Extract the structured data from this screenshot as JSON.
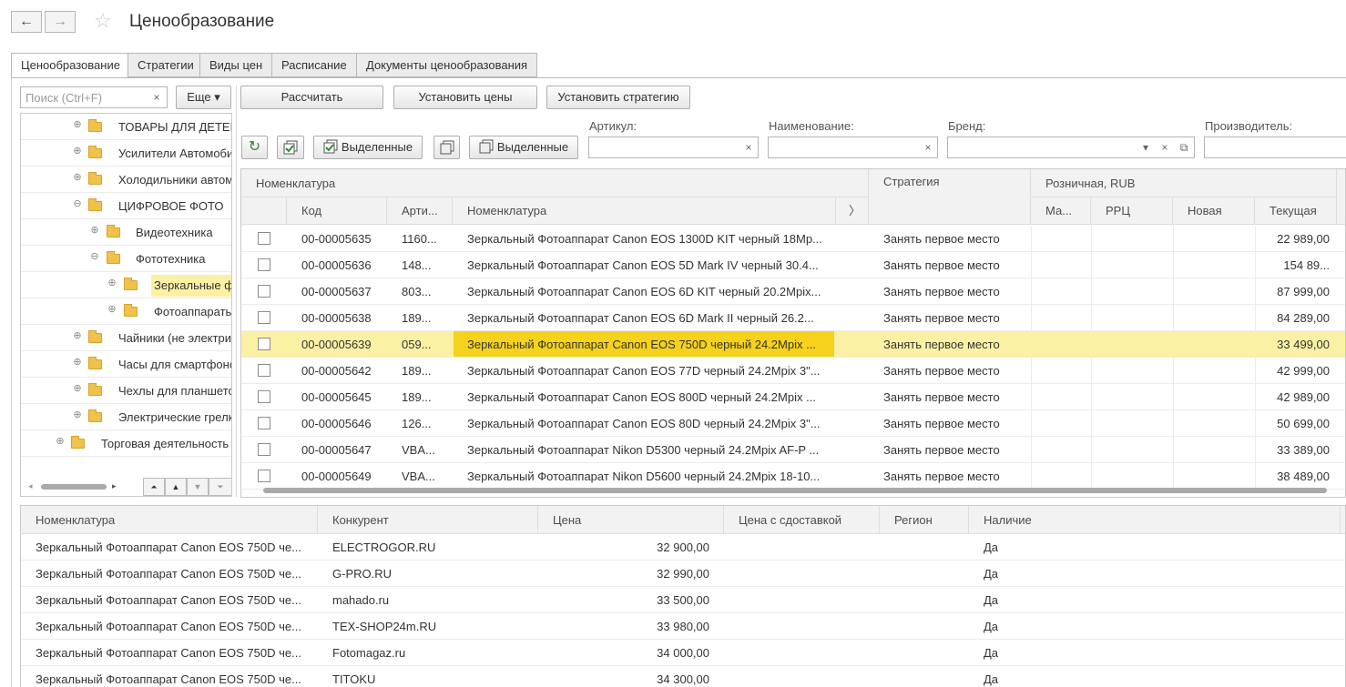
{
  "window": {
    "title": "Ценообразование",
    "back_icon": "←",
    "forward_icon": "→",
    "star_icon": "☆"
  },
  "tabs": [
    {
      "label": "Ценообразование",
      "active": true
    },
    {
      "label": "Стратегии"
    },
    {
      "label": "Виды цен"
    },
    {
      "label": "Расписание"
    },
    {
      "label": "Документы ценообразования"
    }
  ],
  "search": {
    "placeholder": "Поиск (Ctrl+F)",
    "clear": "×",
    "more_label": "Еще ▾"
  },
  "actions": {
    "calculate": "Рассчитать",
    "set_prices": "Установить цены",
    "set_strategy": "Установить стратегию"
  },
  "toolbar": {
    "refresh_icon": "↻",
    "check_selected": "Выделенные",
    "uncheck_selected": "Выделенные"
  },
  "filters": {
    "article": {
      "label": "Артикул:",
      "clear": "×"
    },
    "name": {
      "label": "Наименование:",
      "clear": "×"
    },
    "brand": {
      "label": "Бренд:",
      "dropdown": "▾",
      "clear": "×",
      "open": "⧉"
    },
    "manufacturer": {
      "label": "Производитель:"
    }
  },
  "tree": {
    "items": [
      {
        "label": "ТОВАРЫ ДЛЯ ДЕТЕЙ",
        "expander": "⊕"
      },
      {
        "label": "Усилители Автомобильные",
        "expander": "⊕"
      },
      {
        "label": "Холодильники автомобильные",
        "expander": "⊕"
      },
      {
        "label": "ЦИФРОВОЕ ФОТО",
        "expander": "⊖"
      },
      {
        "label": "Видеотехника",
        "expander": "⊕"
      },
      {
        "label": "Фототехника",
        "expander": "⊖"
      },
      {
        "label": "Зеркальные фотоаппараты",
        "expander": "⊕",
        "selected": true
      },
      {
        "label": "Фотоаппараты",
        "expander": "⊕"
      },
      {
        "label": "Чайники (не электрические)",
        "expander": "⊕"
      },
      {
        "label": "Часы для смартфонов",
        "expander": "⊕"
      },
      {
        "label": "Чехлы для планшетов",
        "expander": "⊕"
      },
      {
        "label": "Электрические грелки",
        "expander": "⊕"
      },
      {
        "label": "Торговая деятельность",
        "expander": "⊕"
      }
    ],
    "scroll_left": "◂",
    "scroll_right": "▸",
    "nav": {
      "first": "⏶",
      "up": "▲",
      "down": "▼",
      "last": "⏷"
    }
  },
  "grid": {
    "group_headers": {
      "nomenclature": "Номенклатура",
      "strategy": "Стратегия",
      "retail": "Розничная, RUB"
    },
    "columns": {
      "code": "Код",
      "article": "Арти...",
      "name": "Номенклатура",
      "chevron": "〉",
      "min": "Ма...",
      "rrc": "РРЦ",
      "new": "Новая",
      "current": "Текущая"
    },
    "rows": [
      {
        "code": "00-00005635",
        "article": "1160...",
        "name": "Зеркальный Фотоаппарат Canon EOS 1300D KIT черный 18Mp...",
        "strategy": "Занять первое место",
        "current": "22 989,00"
      },
      {
        "code": "00-00005636",
        "article": "148...",
        "name": "Зеркальный Фотоаппарат Canon EOS 5D Mark IV черный 30.4...",
        "strategy": "Занять первое место",
        "current": "154 89..."
      },
      {
        "code": "00-00005637",
        "article": "803...",
        "name": "Зеркальный Фотоаппарат Canon EOS 6D KIT черный 20.2Mpix...",
        "strategy": "Занять первое место",
        "current": "87 999,00"
      },
      {
        "code": "00-00005638",
        "article": "189...",
        "name": "Зеркальный Фотоаппарат Canon EOS 6D Mark II черный 26.2...",
        "strategy": "Занять первое место",
        "current": "84 289,00"
      },
      {
        "code": "00-00005639",
        "article": "059...",
        "name": "Зеркальный Фотоаппарат Canon EOS 750D черный 24.2Mpix ...",
        "strategy": "Занять первое место",
        "current": "33 499,00",
        "selected": true
      },
      {
        "code": "00-00005642",
        "article": "189...",
        "name": "Зеркальный Фотоаппарат Canon EOS 77D черный 24.2Mpix 3\"...",
        "strategy": "Занять первое место",
        "current": "42 999,00"
      },
      {
        "code": "00-00005645",
        "article": "189...",
        "name": "Зеркальный Фотоаппарат Canon EOS 800D черный 24.2Mpix ...",
        "strategy": "Занять первое место",
        "current": "42 989,00"
      },
      {
        "code": "00-00005646",
        "article": "126...",
        "name": "Зеркальный Фотоаппарат Canon EOS 80D черный 24.2Mpix 3\"...",
        "strategy": "Занять первое место",
        "current": "50 699,00"
      },
      {
        "code": "00-00005647",
        "article": "VBA...",
        "name": "Зеркальный Фотоаппарат Nikon D5300 черный 24.2Mpix AF-P ...",
        "strategy": "Занять первое место",
        "current": "33 389,00"
      },
      {
        "code": "00-00005649",
        "article": "VBA...",
        "name": "Зеркальный Фотоаппарат Nikon D5600 черный 24.2Mpix 18-10...",
        "strategy": "Занять первое место",
        "current": "38 489,00"
      }
    ]
  },
  "competitors": {
    "columns": {
      "name": "Номенклатура",
      "competitor": "Конкурент",
      "price": "Цена",
      "price_delivery": "Цена с сдоставкой",
      "region": "Регион",
      "availability": "Наличие"
    },
    "rows": [
      {
        "name": "Зеркальный Фотоаппарат Canon EOS 750D че...",
        "competitor": "ELECTROGOR.RU",
        "price": "32 900,00",
        "availability": "Да"
      },
      {
        "name": "Зеркальный Фотоаппарат Canon EOS 750D че...",
        "competitor": "G-PRO.RU",
        "price": "32 990,00",
        "availability": "Да"
      },
      {
        "name": "Зеркальный Фотоаппарат Canon EOS 750D че...",
        "competitor": "mahado.ru",
        "price": "33 500,00",
        "availability": "Да"
      },
      {
        "name": "Зеркальный Фотоаппарат Canon EOS 750D че...",
        "competitor": "TEX-SHOP24m.RU",
        "price": "33 980,00",
        "availability": "Да"
      },
      {
        "name": "Зеркальный Фотоаппарат Canon EOS 750D че...",
        "competitor": "Fotomagaz.ru",
        "price": "34 000,00",
        "availability": "Да"
      },
      {
        "name": "Зеркальный Фотоаппарат Canon EOS 750D че...",
        "competitor": "TITOKU",
        "price": "34 300,00",
        "availability": "Да"
      }
    ]
  },
  "colors": {
    "selection": "#fbf1a5",
    "selected_cell": "#f5d21c",
    "tree_selected": "#fbf1a5"
  }
}
